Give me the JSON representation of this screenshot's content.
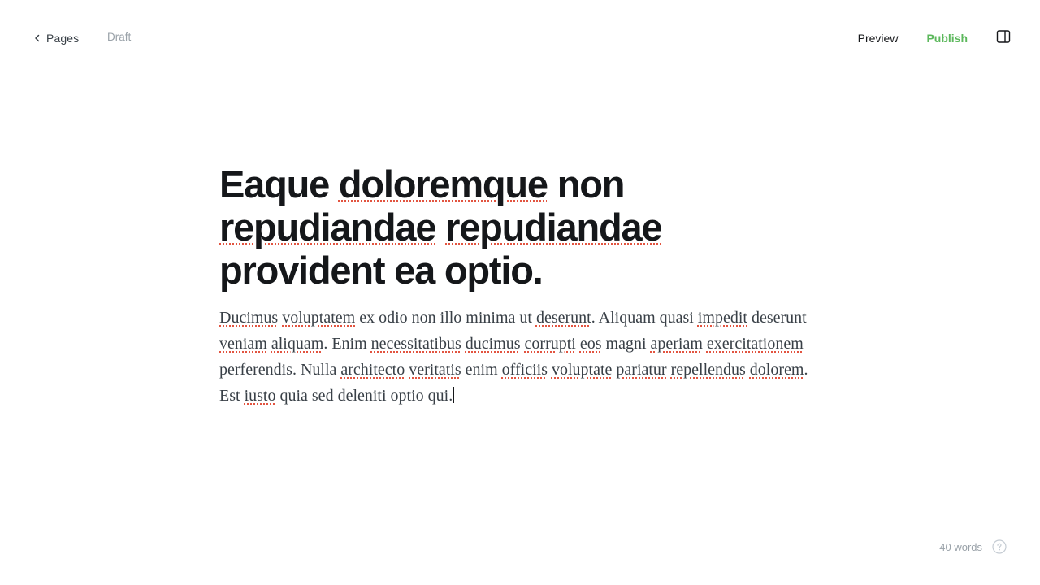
{
  "header": {
    "back_label": "Pages",
    "status": "Draft",
    "preview_label": "Preview",
    "publish_label": "Publish",
    "publish_color": "#5cb85c",
    "icons": {
      "back": "chevron-left-icon",
      "panel": "sidebar-panel-icon"
    }
  },
  "editor": {
    "title_words": [
      [
        "Eaque",
        false
      ],
      [
        " ",
        false
      ],
      [
        "doloremque",
        true
      ],
      [
        " non ",
        false
      ],
      [
        "repudiandae",
        true
      ],
      [
        " ",
        false
      ],
      [
        "repudiandae",
        true
      ],
      [
        " provident ea optio.",
        false
      ]
    ],
    "body_words": [
      [
        "Ducimus",
        true
      ],
      [
        " ",
        false
      ],
      [
        "voluptatem",
        true
      ],
      [
        " ex odio non illo minima ut ",
        false
      ],
      [
        "deserunt",
        true
      ],
      [
        ". Aliquam quasi ",
        false
      ],
      [
        "impedit",
        true
      ],
      [
        " deserunt ",
        false
      ],
      [
        "veniam",
        true
      ],
      [
        " ",
        false
      ],
      [
        "aliquam",
        true
      ],
      [
        ". Enim ",
        false
      ],
      [
        "necessitatibus",
        true
      ],
      [
        " ",
        false
      ],
      [
        "ducimus",
        true
      ],
      [
        " ",
        false
      ],
      [
        "corrupti",
        true
      ],
      [
        " ",
        false
      ],
      [
        "eos",
        true
      ],
      [
        " magni ",
        false
      ],
      [
        "aperiam",
        true
      ],
      [
        " ",
        false
      ],
      [
        "exercitationem",
        true
      ],
      [
        " perferendis. Nulla ",
        false
      ],
      [
        "architecto",
        true
      ],
      [
        " ",
        false
      ],
      [
        "veritatis",
        true
      ],
      [
        " enim ",
        false
      ],
      [
        "officiis",
        true
      ],
      [
        " ",
        false
      ],
      [
        "voluptate",
        true
      ],
      [
        " ",
        false
      ],
      [
        "pariatur",
        true
      ],
      [
        " ",
        false
      ],
      [
        "repellendus",
        true
      ],
      [
        " ",
        false
      ],
      [
        "dolorem",
        true
      ],
      [
        ". Est ",
        false
      ],
      [
        "iusto",
        true
      ],
      [
        " quia sed deleniti optio qui.",
        false
      ]
    ]
  },
  "footer": {
    "word_count": "40 words",
    "help_icon": "help-circle-icon"
  }
}
